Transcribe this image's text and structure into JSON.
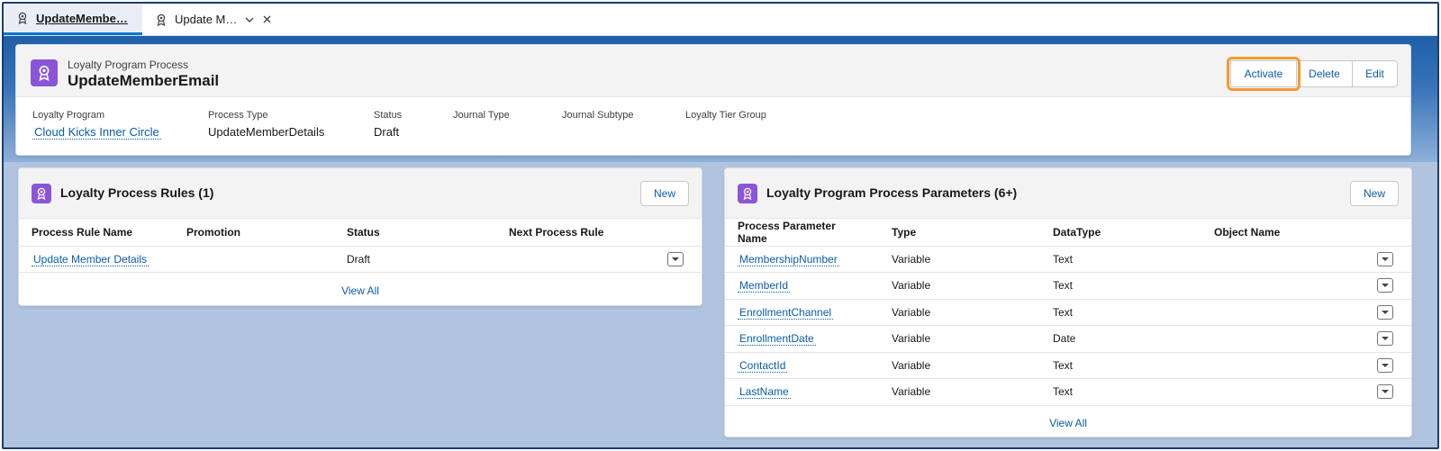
{
  "tabs": [
    {
      "label": "UpdateMembe…",
      "active": true
    },
    {
      "label": "Update M…",
      "active": false
    }
  ],
  "colors": {
    "accent": "#0176d3",
    "object_icon": "#8a55d8",
    "highlight": "#f29b30",
    "link": "#0b5cab"
  },
  "record": {
    "object_type": "Loyalty Program Process",
    "title": "UpdateMemberEmail",
    "buttons": {
      "activate": "Activate",
      "delete": "Delete",
      "edit": "Edit"
    },
    "fields": [
      {
        "label": "Loyalty Program",
        "value": "Cloud Kicks Inner Circle",
        "link": true
      },
      {
        "label": "Process Type",
        "value": "UpdateMemberDetails",
        "link": false
      },
      {
        "label": "Status",
        "value": "Draft",
        "link": false
      },
      {
        "label": "Journal Type",
        "value": "",
        "link": false
      },
      {
        "label": "Journal Subtype",
        "value": "",
        "link": false
      },
      {
        "label": "Loyalty Tier Group",
        "value": "",
        "link": false
      }
    ]
  },
  "rules": {
    "title": "Loyalty Process Rules (1)",
    "new_label": "New",
    "columns": [
      "Process Rule Name",
      "Promotion",
      "Status",
      "Next Process Rule"
    ],
    "rows": [
      {
        "name": "Update Member Details",
        "promotion": "",
        "status": "Draft",
        "next": ""
      }
    ],
    "view_all": "View All"
  },
  "params": {
    "title": "Loyalty Program Process Parameters (6+)",
    "new_label": "New",
    "columns": [
      "Process Parameter Name",
      "Type",
      "DataType",
      "Object Name"
    ],
    "rows": [
      {
        "name": "MembershipNumber",
        "type": "Variable",
        "datatype": "Text",
        "object": ""
      },
      {
        "name": "MemberId",
        "type": "Variable",
        "datatype": "Text",
        "object": ""
      },
      {
        "name": "EnrollmentChannel",
        "type": "Variable",
        "datatype": "Text",
        "object": ""
      },
      {
        "name": "EnrollmentDate",
        "type": "Variable",
        "datatype": "Date",
        "object": ""
      },
      {
        "name": "ContactId",
        "type": "Variable",
        "datatype": "Text",
        "object": ""
      },
      {
        "name": "LastName",
        "type": "Variable",
        "datatype": "Text",
        "object": ""
      }
    ],
    "view_all": "View All"
  }
}
